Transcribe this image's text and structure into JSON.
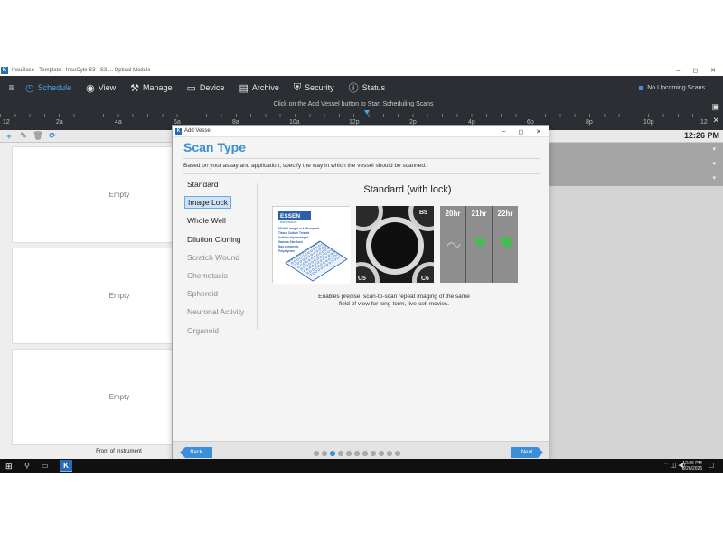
{
  "window": {
    "title": "IncuBase - Template - IncuCyte S3 - S3 ... Optical Module",
    "app_letter": "K",
    "minimize": "–",
    "maximize": "◻",
    "close": "✕"
  },
  "menu": {
    "items": [
      {
        "label": "Schedule",
        "icon": "clock-icon"
      },
      {
        "label": "View",
        "icon": "eye-icon"
      },
      {
        "label": "Manage",
        "icon": "wrench-icon"
      },
      {
        "label": "Device",
        "icon": "device-icon"
      },
      {
        "label": "Archive",
        "icon": "archive-icon"
      },
      {
        "label": "Security",
        "icon": "shield-icon"
      },
      {
        "label": "Status",
        "icon": "info-icon"
      }
    ],
    "upcoming": "No Upcoming Scans"
  },
  "timeline": {
    "hint": "Click on the Add Vessel button to Start Scheduling Scans",
    "labels": [
      "12",
      "2a",
      "4a",
      "6a",
      "8a",
      "10a",
      "12p",
      "2p",
      "4p",
      "6p",
      "8p",
      "10p",
      "12"
    ]
  },
  "toolbar": {
    "add": "+",
    "time": "12:26 PM"
  },
  "vessels": {
    "slots": [
      "Empty",
      "Empty",
      "Empty"
    ],
    "front_label": "Front of Instrument"
  },
  "dialog": {
    "window_title": "Add Vessel",
    "heading": "Scan Type",
    "subtitle": "Based on your assay and application, specify the way in which the vessel should be scanned.",
    "options": [
      {
        "label": "Standard",
        "state": "normal"
      },
      {
        "label": "Image Lock",
        "state": "selected"
      },
      {
        "label": "Whole Well",
        "state": "normal"
      },
      {
        "label": "Dilution Cloning",
        "state": "normal"
      },
      {
        "label": "Scratch Wound",
        "state": "disabled"
      },
      {
        "label": "Chemotaxis",
        "state": "disabled"
      },
      {
        "label": "Spheroid",
        "state": "disabled"
      },
      {
        "label": "Neuronal Activity",
        "state": "disabled"
      },
      {
        "label": "Organoid",
        "state": "disabled"
      }
    ],
    "detail_title": "Standard (with lock)",
    "plate": {
      "brand": "ESSEN",
      "brand_sub": "BIOSCIENCE",
      "lines": [
        "96 Well ImageLock Microplate",
        "Tissue Culture Treated",
        "Individually Packaged",
        "Gamma Sterilized",
        "Non-pyrogenic",
        "Polystyrene"
      ]
    },
    "well_labels": [
      "B5",
      "C5",
      "C6"
    ],
    "time_labels": [
      "20hr",
      "21hr",
      "22hr"
    ],
    "description": "Enables precise, scan-to-scan repeat imaging of the same field of view for long-term, live-cell movies.",
    "back_label": "Back",
    "next_label": "Next",
    "steps_total": 11,
    "current_step": 3
  },
  "taskbar": {
    "time": "12:26 PM",
    "date": "8/26/2025"
  },
  "colors": {
    "accent": "#3a8fd8",
    "menubar": "#2b2f33",
    "selection": "#cfe3f6"
  }
}
